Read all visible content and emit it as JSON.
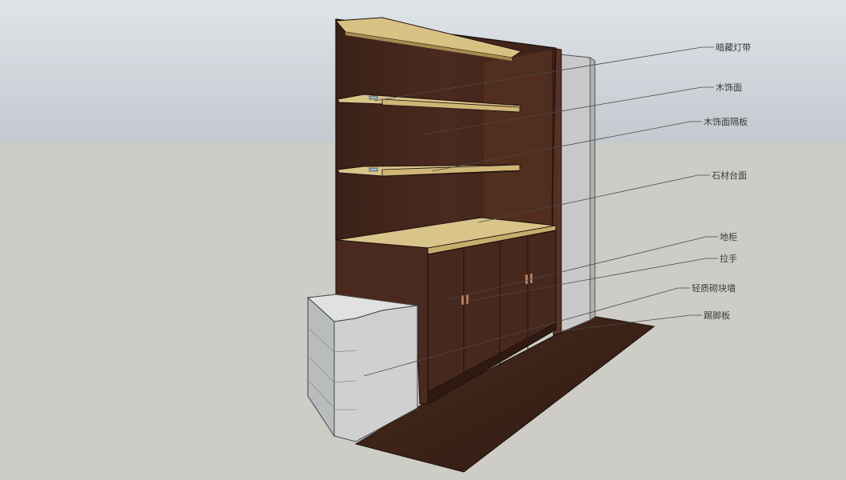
{
  "scene": {
    "sky_color": "#c4cbd1",
    "ground_color": "#cdccc6"
  },
  "annotations": [
    {
      "id": "hidden-light-strip",
      "text": "暗藏灯带"
    },
    {
      "id": "wood-veneer",
      "text": "木饰面"
    },
    {
      "id": "wood-veneer-shelf",
      "text": "木饰面隔板"
    },
    {
      "id": "stone-countertop",
      "text": "石材台面"
    },
    {
      "id": "base-cabinet",
      "text": "地柜"
    },
    {
      "id": "handle",
      "text": "拉手"
    },
    {
      "id": "lightweight-block-wall",
      "text": "轻质砌块墙"
    },
    {
      "id": "kickboard",
      "text": "踢脚板"
    }
  ],
  "colors": {
    "wood_dark": "#3d2219",
    "wood_mid": "#4c2b20",
    "board_face": "#d9c48a",
    "concrete": "#c9cbcb",
    "floor": "#3a2217",
    "handle": "#c48a68"
  }
}
